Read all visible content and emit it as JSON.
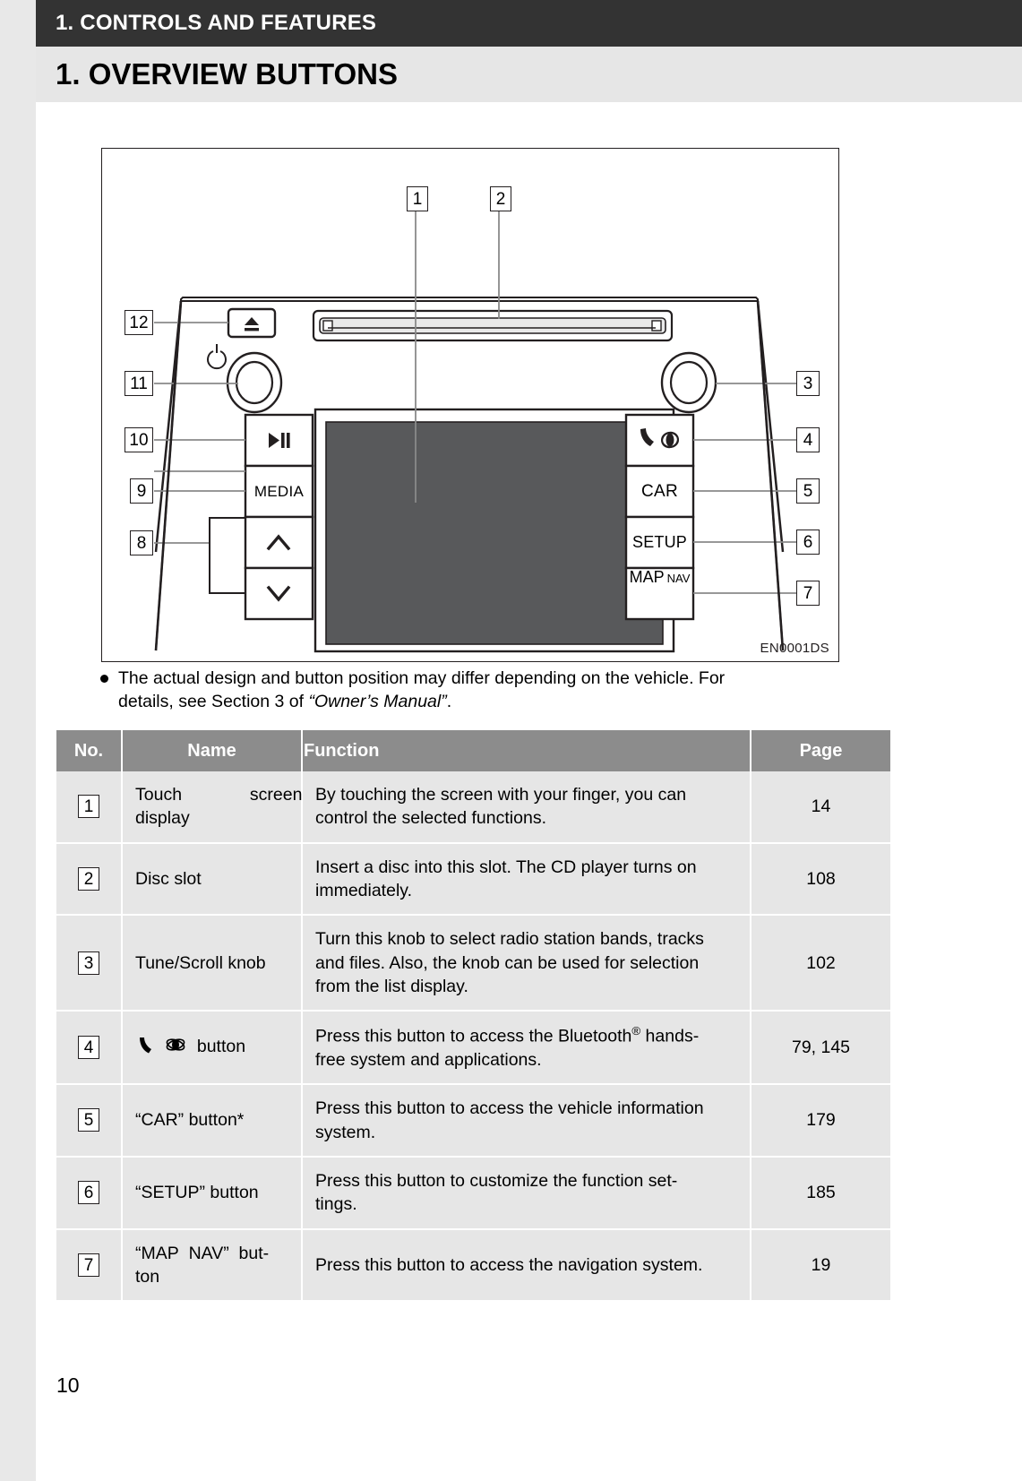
{
  "header": {
    "section_bar": "1. CONTROLS AND FEATURES",
    "chapter_title": "1. OVERVIEW BUTTONS"
  },
  "figure": {
    "code": "EN0001DS",
    "callouts": [
      "1",
      "2",
      "3",
      "4",
      "5",
      "6",
      "7",
      "8",
      "9",
      "10",
      "11",
      "12"
    ],
    "unit_labels": {
      "media": "MEDIA",
      "car": "CAR",
      "setup": "SETUP",
      "map_nav_main": "MAP",
      "map_nav_sub": "NAV"
    },
    "icon_names": {
      "eject": "eject-icon",
      "power": "power-icon",
      "play_pause": "play-pause-icon",
      "seek_up": "chevron-up-icon",
      "seek_down": "chevron-down-icon",
      "phone": "phone-handset-icon",
      "bluetooth_apps": "apps-globe-icon"
    }
  },
  "note": {
    "bullet": "●",
    "line1": "The actual design and button position may differ depending on the vehicle. For",
    "line2_pre": "details, see Section 3 of ",
    "line2_italic": "“Owner’s Manual”",
    "line2_post": "."
  },
  "table": {
    "headers": [
      "No.",
      "Name",
      "Function",
      "Page"
    ],
    "rows": [
      {
        "no": "1",
        "name": "Touch screen display",
        "function": "By touching the screen with your finger, you can control the selected functions.",
        "function_lines": [
          "By touching the screen with your finger, you can",
          "control the selected functions."
        ],
        "page": "14"
      },
      {
        "no": "2",
        "name": "Disc slot",
        "function": "Insert a disc into this slot. The CD player turns on immediately.",
        "function_lines": [
          "Insert a disc into this slot. The CD player turns on",
          "immediately."
        ],
        "page": "108"
      },
      {
        "no": "3",
        "name": "Tune/Scroll knob",
        "function": "Turn this knob to select radio station bands, tracks and files. Also, the knob can be used for selection from the list display.",
        "function_lines": [
          "Turn this knob to select radio station bands, tracks",
          "and files. Also, the knob can be used for selection",
          "from the list display."
        ],
        "page": "102"
      },
      {
        "no": "4",
        "name": "button",
        "name_has_icons": true,
        "function": "Press this button to access the Bluetooth® hands-free system and applications.",
        "function_lines": [
          "Press this button to access the Bluetooth® hands-",
          "free system and applications."
        ],
        "page": "79, 145"
      },
      {
        "no": "5",
        "name": "“CAR” button*",
        "function": "Press this button to access the vehicle information system.",
        "function_lines": [
          "Press this button to access the vehicle information",
          "system."
        ],
        "page": "179"
      },
      {
        "no": "6",
        "name": "“SETUP” button",
        "function": "Press this button to customize the function settings.",
        "function_lines": [
          "Press this button to customize the function set-",
          "tings."
        ],
        "page": "185"
      },
      {
        "no": "7",
        "name": "“MAP NAV” button",
        "function": "Press this button to access the navigation system.",
        "function_lines": [
          "Press this button to access the navigation system."
        ],
        "page": "19"
      }
    ]
  },
  "footer": {
    "page_number": "10"
  }
}
